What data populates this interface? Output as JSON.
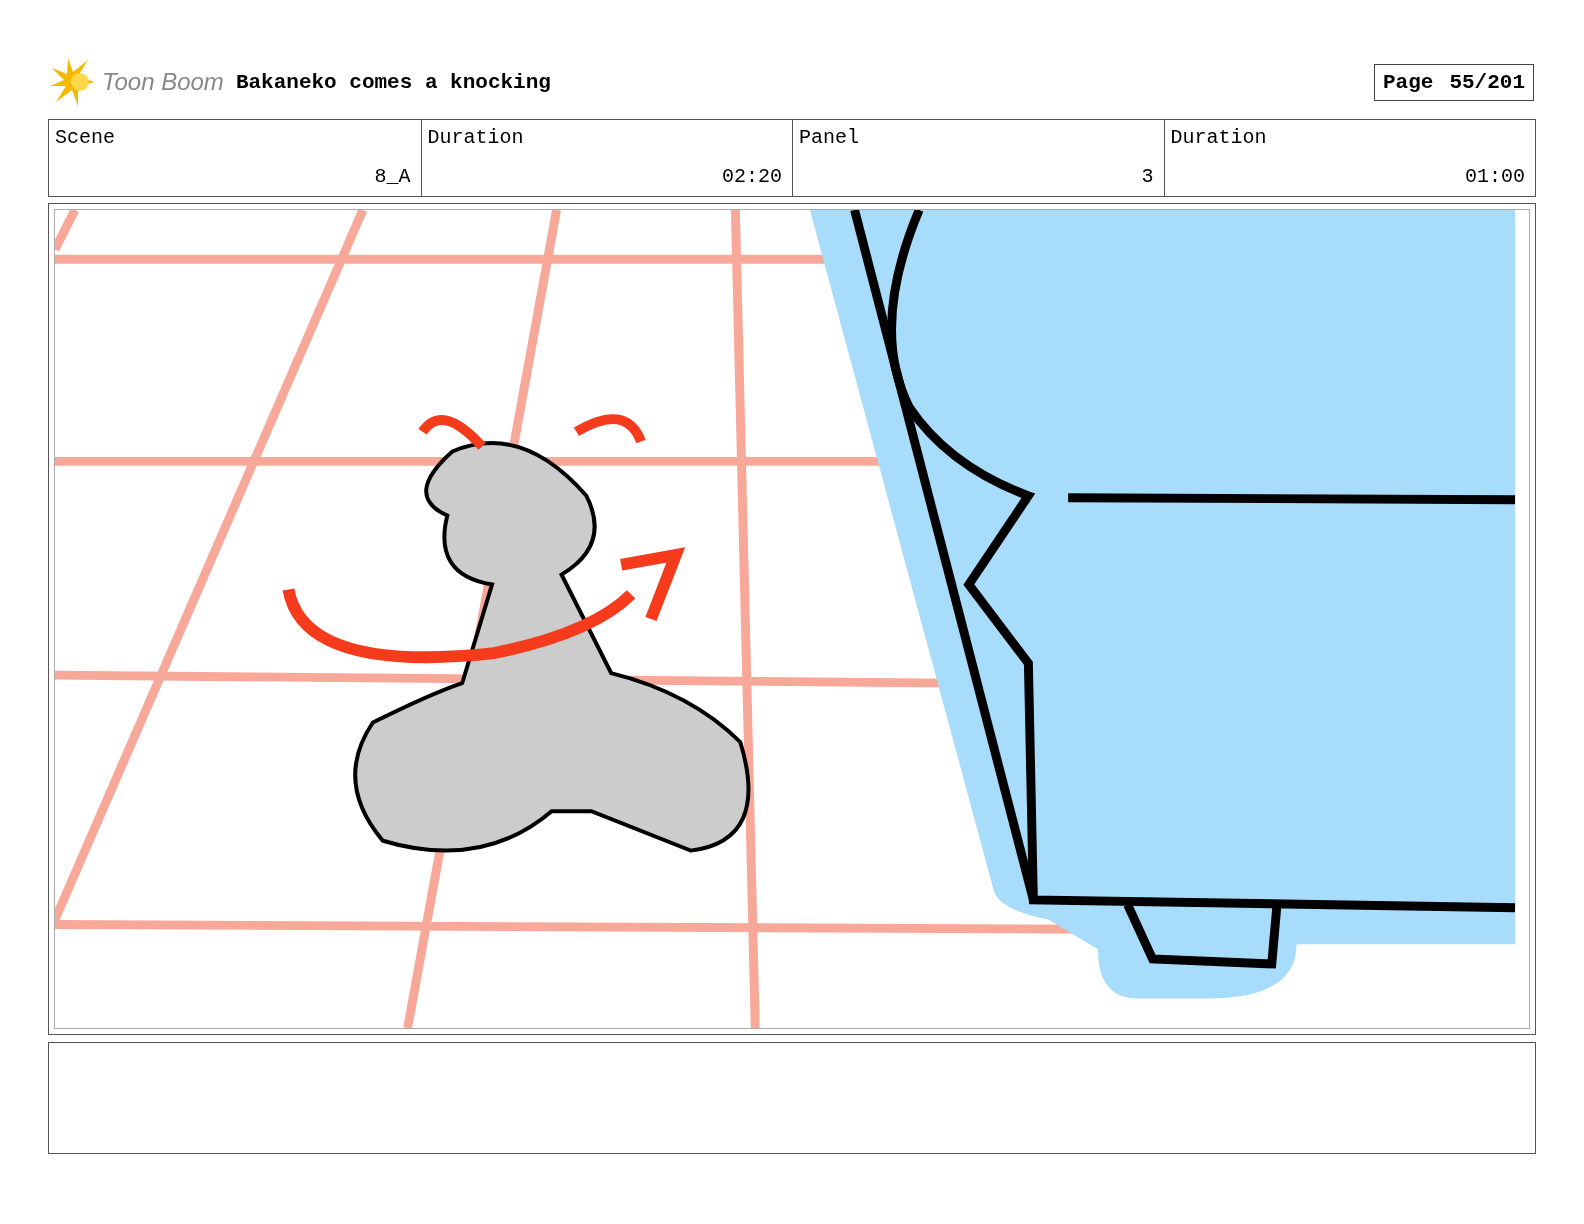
{
  "header": {
    "logo_text": "Toon Boom",
    "title": "Bakaneko comes a knocking",
    "page_label": "Page",
    "page_number": "55/201"
  },
  "info_table": {
    "columns": [
      "Scene",
      "Duration",
      "Panel",
      "Duration"
    ],
    "row": [
      "8_A",
      "02:20",
      "3",
      "01:00"
    ]
  }
}
